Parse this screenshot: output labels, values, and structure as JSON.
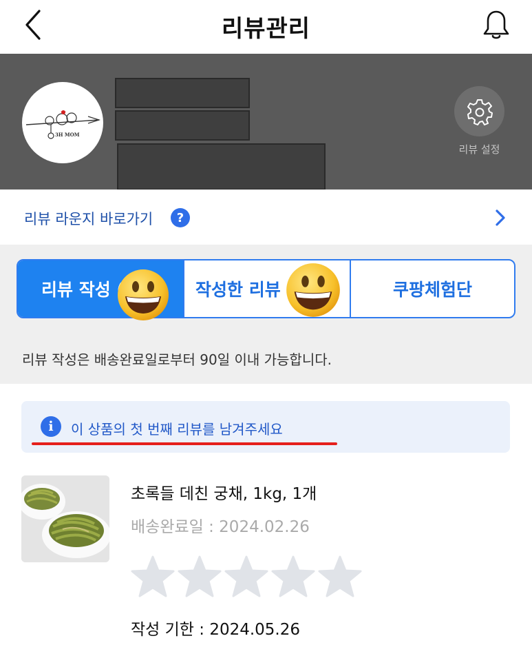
{
  "header": {
    "title": "리뷰관리",
    "back_icon": "chevron-left-icon",
    "bell_icon": "bell-icon"
  },
  "profile": {
    "avatar_text": "3H MOM",
    "settings_label": "리뷰 설정",
    "settings_icon": "gear-icon"
  },
  "lounge": {
    "label": "리뷰 라운지 바로가기",
    "help_glyph": "?"
  },
  "tabs": [
    {
      "label": "리뷰 작성 (",
      "active": true
    },
    {
      "label": "작성한 리뷰",
      "active": false
    },
    {
      "label": "쿠팡체험단",
      "active": false
    }
  ],
  "notice": "리뷰 작성은 배송완료일로부터 90일 이내 가능합니다.",
  "info_banner": {
    "glyph": "i",
    "text": "이 상품의 첫 번째 리뷰를 남겨주세요"
  },
  "product": {
    "name": "초록들 데친 궁채, 1kg, 1개",
    "delivery_date": "배송완료일 : 2024.02.26",
    "rating": 0,
    "rating_max": 5,
    "deadline": "작성 기한 : 2024.05.26"
  },
  "colors": {
    "accent": "#1e82f0",
    "banner_bg": "#5a5a5a",
    "underline": "#e5201b",
    "star_empty": "#e0e3e8"
  }
}
